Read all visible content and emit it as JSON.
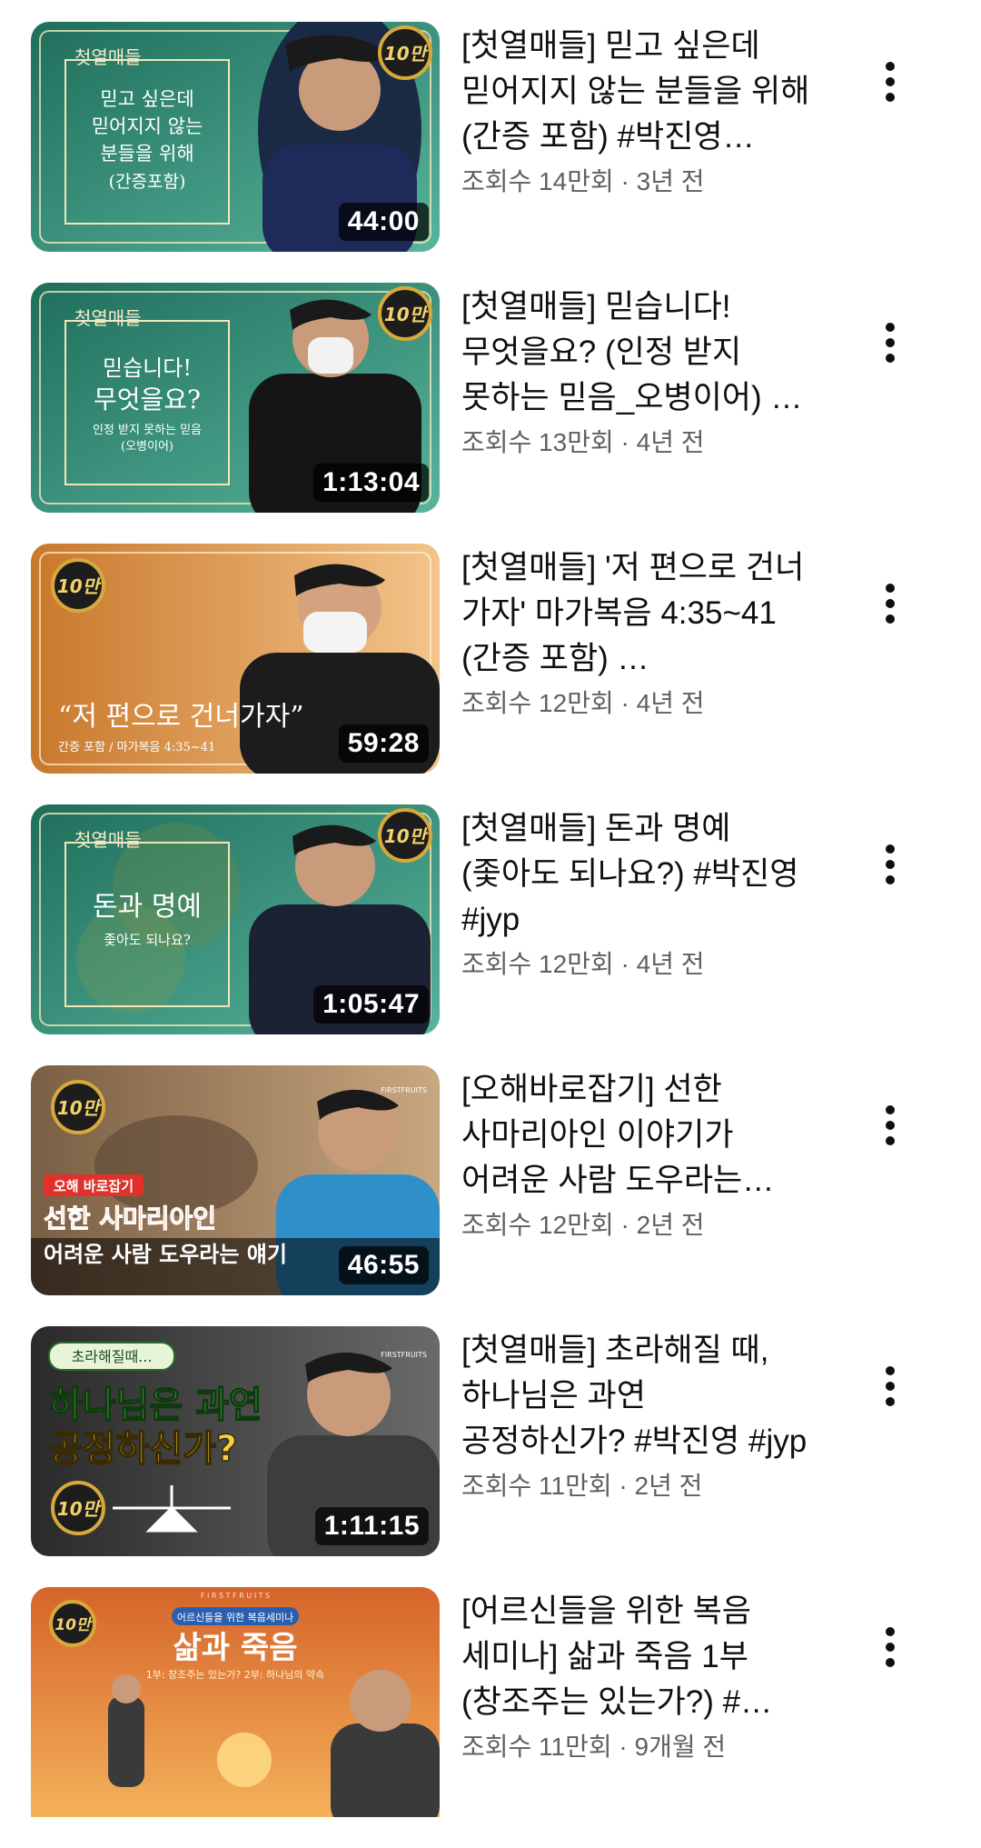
{
  "videos": [
    {
      "title": "[첫열매들] 믿고 싶은데 믿어지지 않는 분들을 위해(간증 포함) #박진영…",
      "views": "조회수 14만회",
      "age": "3년 전",
      "duration": "44:00",
      "badge": "10만",
      "thumb": {
        "series": "첫열매들",
        "lines": [
          "믿고 싶은데",
          "믿어지지 않는",
          "분들을 위해",
          "(간증포함)"
        ],
        "bg1": "#1e6b5a",
        "bg2": "#4aa892"
      }
    },
    {
      "title": "[첫열매들] 믿습니다! 무엇을요? (인정 받지 못하는 믿음_오병이어) #박…",
      "views": "조회수 13만회",
      "age": "4년 전",
      "duration": "1:13:04",
      "badge": "10만",
      "thumb": {
        "series": "첫열매들",
        "lines": [
          "믿습니다!",
          "무엇을요?",
          "인정 받지 못하는 믿음",
          "(오병이어)"
        ],
        "bg1": "#1e6b5a",
        "bg2": "#4aa892"
      }
    },
    {
      "title": "[첫열매들] '저 편으로 건너 가자' 마가복음 4:35~41 (간증 포함) …",
      "views": "조회수 12만회",
      "age": "4년 전",
      "duration": "59:28",
      "badge": "10만",
      "thumb": {
        "headline": "“저 편으로 건너가자”",
        "caption": "간증 포함 / 마가복음 4:35~41",
        "bg1": "#b5651d",
        "bg2": "#f1b36a"
      }
    },
    {
      "title": "[첫열매들] 돈과 명예 (좇아도 되나요?) #박진영 #jyp",
      "views": "조회수 12만회",
      "age": "4년 전",
      "duration": "1:05:47",
      "badge": "10만",
      "thumb": {
        "series": "첫열매들",
        "lines": [
          "돈과 명예",
          "좇아도 되나요?"
        ],
        "bg1": "#1e6b5a",
        "bg2": "#4aa892"
      }
    },
    {
      "title": "[오해바로잡기] 선한 사마리아인 이야기가 어려운 사람 도우라는 얘기라…",
      "views": "조회수 12만회",
      "age": "2년 전",
      "duration": "46:55",
      "badge": "10만",
      "thumb": {
        "tag": "오해 바로잡기",
        "headline": "선한 사마리아인",
        "sub": "어려운 사람 도우라는 얘기",
        "logo": "FIRSTFRUITS",
        "bg1": "#8a6d4f",
        "bg2": "#c7a27a"
      }
    },
    {
      "title": "[첫열매들] 초라해질 때, 하나님은 과연 공정하신가? #박진영 #jyp",
      "views": "조회수 11만회",
      "age": "2년 전",
      "duration": "1:11:15",
      "badge": "10만",
      "thumb": {
        "tag": "초라해질때...",
        "headline": "하나님은 과연",
        "headline2": "공정하신가?",
        "logo": "FIRSTFRUITS",
        "bg1": "#2b2b2b",
        "bg2": "#5a5a5a"
      }
    },
    {
      "title": "[어르신들을 위한 복음 세미나] 삶과 죽음 1부(창조주는 있는가?) #박진영…",
      "views": "조회수 11만회",
      "age": "9개월 전",
      "duration": "",
      "badge": "10만",
      "thumb": {
        "tag": "어르신들을 위한 복음세미나",
        "headline": "삶과 죽음",
        "caption": "1부: 창조주는 있는가?  2부: 하나님의 약속",
        "logo": "F I R S T F R U I T S",
        "bg1": "#c2541a",
        "bg2": "#f0a24a"
      }
    }
  ],
  "colors": {
    "title": "#0f0f0f",
    "subtitle": "#606060",
    "badge_gold": "#d8a93a"
  },
  "icons": {
    "menu": "more-vert-icon"
  }
}
